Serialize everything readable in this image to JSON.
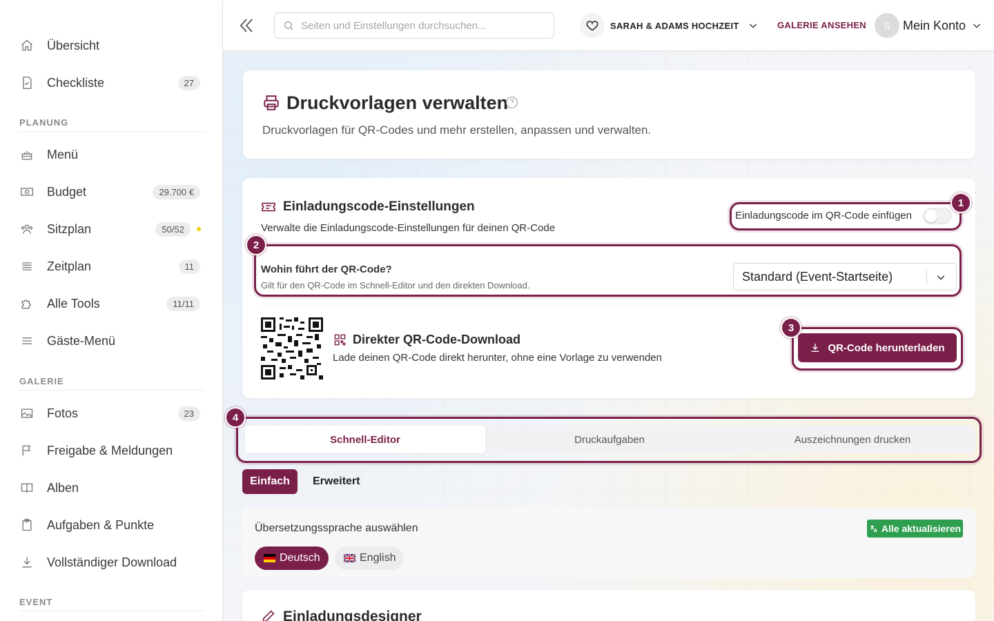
{
  "sidebar": {
    "items_top": [
      {
        "label": "Übersicht",
        "icon": "home-icon",
        "badge": ""
      },
      {
        "label": "Checkliste",
        "icon": "checklist-icon",
        "badge": "27"
      }
    ],
    "section_planung": "PLANUNG",
    "items_planung": [
      {
        "label": "Menü",
        "icon": "cake-icon",
        "badge": ""
      },
      {
        "label": "Budget",
        "icon": "money-icon",
        "badge": "29.700 €"
      },
      {
        "label": "Sitzplan",
        "icon": "users-icon",
        "badge": "50/52"
      },
      {
        "label": "Zeitplan",
        "icon": "schedule-icon",
        "badge": "11"
      },
      {
        "label": "Alle Tools",
        "icon": "puzzle-icon",
        "badge": "11/11"
      },
      {
        "label": "Gäste-Menü",
        "icon": "menu-lines-icon",
        "badge": ""
      }
    ],
    "section_galerie": "GALERIE",
    "items_galerie": [
      {
        "label": "Fotos",
        "icon": "image-icon",
        "badge": "23"
      },
      {
        "label": "Freigabe & Meldungen",
        "icon": "flag-icon",
        "badge": ""
      },
      {
        "label": "Alben",
        "icon": "book-icon",
        "badge": ""
      },
      {
        "label": "Aufgaben & Punkte",
        "icon": "clipboard-icon",
        "badge": ""
      },
      {
        "label": "Vollständiger Download",
        "icon": "download-icon",
        "badge": ""
      }
    ],
    "section_event": "EVENT"
  },
  "topbar": {
    "search_placeholder": "Seiten und Einstellungen durchsuchen...",
    "event_name": "SARAH & ADAMS HOCHZEIT",
    "gallery_link": "GALERIE ANSEHEN",
    "avatar_letter": "S",
    "account_label": "Mein Konto"
  },
  "page": {
    "title": "Druckvorlagen verwalten",
    "subtitle": "Druckvorlagen für QR-Codes und mehr erstellen, anpassen und verwalten."
  },
  "invite_settings": {
    "title": "Einladungscode-Einstellungen",
    "subtitle": "Verwalte die Einladungscode-Einstellungen für deinen QR-Code",
    "toggle_label": "Einladungscode im QR-Code einfügen",
    "toggle_on": false,
    "target_label": "Wohin führt der QR-Code?",
    "target_hint": "Gilt für den QR-Code im Schnell-Editor und den direkten Download.",
    "target_value": "Standard (Event-Startseite)",
    "download_title": "Direkter QR-Code-Download",
    "download_sub": "Lade deinen QR-Code direkt herunter, ohne eine Vorlage zu verwenden",
    "download_button": "QR-Code herunterladen"
  },
  "callouts": [
    "1",
    "2",
    "3",
    "4"
  ],
  "tabs": [
    "Schnell-Editor",
    "Druckaufgaben",
    "Auszeichnungen drucken"
  ],
  "active_tab": 0,
  "mode": {
    "simple": "Einfach",
    "advanced": "Erweitert"
  },
  "translation": {
    "label": "Übersetzungssprache auswählen",
    "update_all": "Alle aktualisieren",
    "languages": [
      {
        "label": "Deutsch",
        "flag": "german-flag-icon",
        "active": true
      },
      {
        "label": "English",
        "flag": "uk-flag-icon",
        "active": false
      }
    ]
  },
  "designer_title": "Einladungsdesigner",
  "colors": {
    "accent": "#7a1f49",
    "green": "#2e9e4f"
  }
}
